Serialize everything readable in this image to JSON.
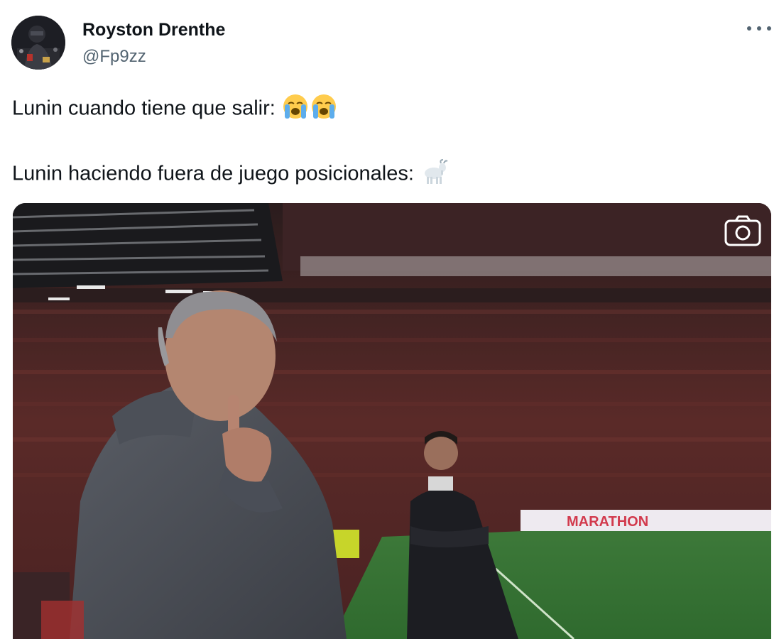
{
  "tweet": {
    "author": {
      "display_name": "Royston Drenthe",
      "handle": "@Fp9zz"
    },
    "text": {
      "line1": "Lunin cuando tiene que salir:",
      "line2": "Lunin haciendo fuera de juego posicionales:"
    },
    "media": {
      "banner_text": "MARATHON"
    }
  },
  "icons": {
    "more": "more-horizontal-icon",
    "camera": "camera-icon",
    "crying": "loudly-crying-face-emoji",
    "goat": "goat-emoji"
  },
  "colors": {
    "text_primary": "#0f1419",
    "text_secondary": "#536471"
  }
}
